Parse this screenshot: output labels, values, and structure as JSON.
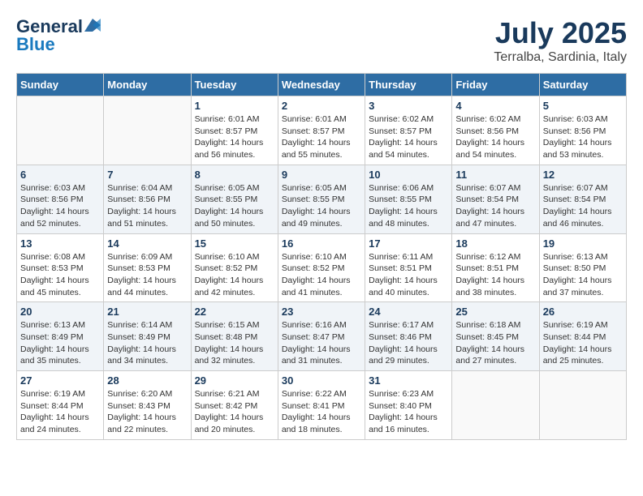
{
  "header": {
    "logo_general": "General",
    "logo_blue": "Blue",
    "month_title": "July 2025",
    "location": "Terralba, Sardinia, Italy"
  },
  "calendar": {
    "weekdays": [
      "Sunday",
      "Monday",
      "Tuesday",
      "Wednesday",
      "Thursday",
      "Friday",
      "Saturday"
    ],
    "weeks": [
      [
        {
          "day": "",
          "info": ""
        },
        {
          "day": "",
          "info": ""
        },
        {
          "day": "1",
          "info": "Sunrise: 6:01 AM\nSunset: 8:57 PM\nDaylight: 14 hours and 56 minutes."
        },
        {
          "day": "2",
          "info": "Sunrise: 6:01 AM\nSunset: 8:57 PM\nDaylight: 14 hours and 55 minutes."
        },
        {
          "day": "3",
          "info": "Sunrise: 6:02 AM\nSunset: 8:57 PM\nDaylight: 14 hours and 54 minutes."
        },
        {
          "day": "4",
          "info": "Sunrise: 6:02 AM\nSunset: 8:56 PM\nDaylight: 14 hours and 54 minutes."
        },
        {
          "day": "5",
          "info": "Sunrise: 6:03 AM\nSunset: 8:56 PM\nDaylight: 14 hours and 53 minutes."
        }
      ],
      [
        {
          "day": "6",
          "info": "Sunrise: 6:03 AM\nSunset: 8:56 PM\nDaylight: 14 hours and 52 minutes."
        },
        {
          "day": "7",
          "info": "Sunrise: 6:04 AM\nSunset: 8:56 PM\nDaylight: 14 hours and 51 minutes."
        },
        {
          "day": "8",
          "info": "Sunrise: 6:05 AM\nSunset: 8:55 PM\nDaylight: 14 hours and 50 minutes."
        },
        {
          "day": "9",
          "info": "Sunrise: 6:05 AM\nSunset: 8:55 PM\nDaylight: 14 hours and 49 minutes."
        },
        {
          "day": "10",
          "info": "Sunrise: 6:06 AM\nSunset: 8:55 PM\nDaylight: 14 hours and 48 minutes."
        },
        {
          "day": "11",
          "info": "Sunrise: 6:07 AM\nSunset: 8:54 PM\nDaylight: 14 hours and 47 minutes."
        },
        {
          "day": "12",
          "info": "Sunrise: 6:07 AM\nSunset: 8:54 PM\nDaylight: 14 hours and 46 minutes."
        }
      ],
      [
        {
          "day": "13",
          "info": "Sunrise: 6:08 AM\nSunset: 8:53 PM\nDaylight: 14 hours and 45 minutes."
        },
        {
          "day": "14",
          "info": "Sunrise: 6:09 AM\nSunset: 8:53 PM\nDaylight: 14 hours and 44 minutes."
        },
        {
          "day": "15",
          "info": "Sunrise: 6:10 AM\nSunset: 8:52 PM\nDaylight: 14 hours and 42 minutes."
        },
        {
          "day": "16",
          "info": "Sunrise: 6:10 AM\nSunset: 8:52 PM\nDaylight: 14 hours and 41 minutes."
        },
        {
          "day": "17",
          "info": "Sunrise: 6:11 AM\nSunset: 8:51 PM\nDaylight: 14 hours and 40 minutes."
        },
        {
          "day": "18",
          "info": "Sunrise: 6:12 AM\nSunset: 8:51 PM\nDaylight: 14 hours and 38 minutes."
        },
        {
          "day": "19",
          "info": "Sunrise: 6:13 AM\nSunset: 8:50 PM\nDaylight: 14 hours and 37 minutes."
        }
      ],
      [
        {
          "day": "20",
          "info": "Sunrise: 6:13 AM\nSunset: 8:49 PM\nDaylight: 14 hours and 35 minutes."
        },
        {
          "day": "21",
          "info": "Sunrise: 6:14 AM\nSunset: 8:49 PM\nDaylight: 14 hours and 34 minutes."
        },
        {
          "day": "22",
          "info": "Sunrise: 6:15 AM\nSunset: 8:48 PM\nDaylight: 14 hours and 32 minutes."
        },
        {
          "day": "23",
          "info": "Sunrise: 6:16 AM\nSunset: 8:47 PM\nDaylight: 14 hours and 31 minutes."
        },
        {
          "day": "24",
          "info": "Sunrise: 6:17 AM\nSunset: 8:46 PM\nDaylight: 14 hours and 29 minutes."
        },
        {
          "day": "25",
          "info": "Sunrise: 6:18 AM\nSunset: 8:45 PM\nDaylight: 14 hours and 27 minutes."
        },
        {
          "day": "26",
          "info": "Sunrise: 6:19 AM\nSunset: 8:44 PM\nDaylight: 14 hours and 25 minutes."
        }
      ],
      [
        {
          "day": "27",
          "info": "Sunrise: 6:19 AM\nSunset: 8:44 PM\nDaylight: 14 hours and 24 minutes."
        },
        {
          "day": "28",
          "info": "Sunrise: 6:20 AM\nSunset: 8:43 PM\nDaylight: 14 hours and 22 minutes."
        },
        {
          "day": "29",
          "info": "Sunrise: 6:21 AM\nSunset: 8:42 PM\nDaylight: 14 hours and 20 minutes."
        },
        {
          "day": "30",
          "info": "Sunrise: 6:22 AM\nSunset: 8:41 PM\nDaylight: 14 hours and 18 minutes."
        },
        {
          "day": "31",
          "info": "Sunrise: 6:23 AM\nSunset: 8:40 PM\nDaylight: 14 hours and 16 minutes."
        },
        {
          "day": "",
          "info": ""
        },
        {
          "day": "",
          "info": ""
        }
      ]
    ]
  }
}
